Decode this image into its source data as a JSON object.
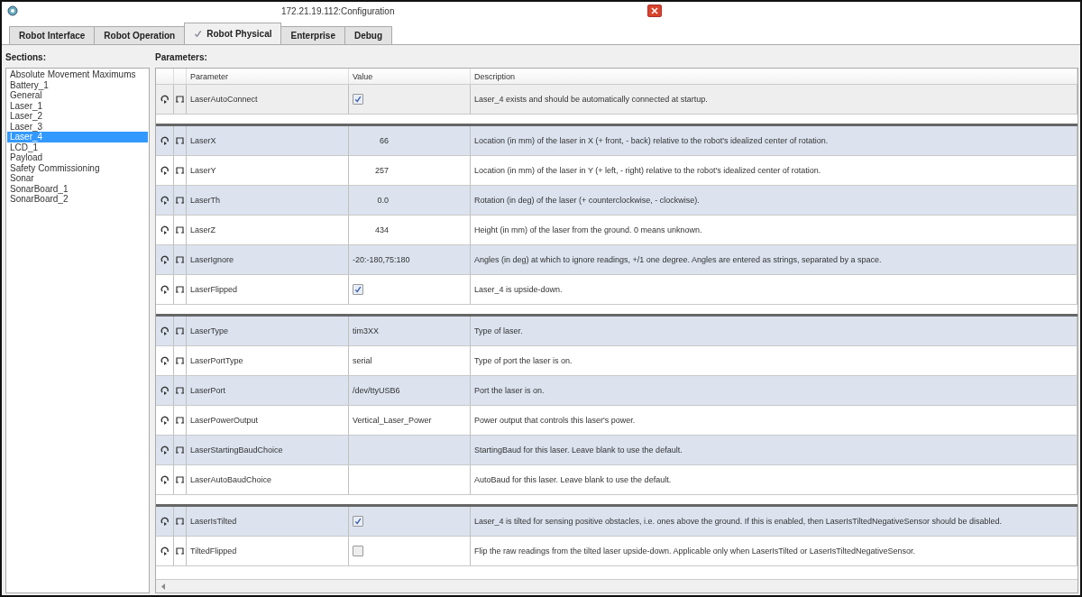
{
  "window": {
    "title": "172.21.19.112:Configuration"
  },
  "tabs": [
    {
      "label": "Robot Interface",
      "selected": false,
      "modified": false
    },
    {
      "label": "Robot Operation",
      "selected": false,
      "modified": false
    },
    {
      "label": "Robot Physical",
      "selected": true,
      "modified": true
    },
    {
      "label": "Enterprise",
      "selected": false,
      "modified": false
    },
    {
      "label": "Debug",
      "selected": false,
      "modified": false
    }
  ],
  "sections": {
    "label": "Sections:",
    "items": [
      {
        "label": "Absolute Movement Maximums",
        "selected": false
      },
      {
        "label": "Battery_1",
        "selected": false
      },
      {
        "label": "General",
        "selected": false
      },
      {
        "label": "Laser_1",
        "selected": false
      },
      {
        "label": "Laser_2",
        "selected": false
      },
      {
        "label": "Laser_3",
        "selected": false
      },
      {
        "label": "Laser_4",
        "selected": true
      },
      {
        "label": "LCD_1",
        "selected": false
      },
      {
        "label": "Payload",
        "selected": false
      },
      {
        "label": "Safety Commissioning",
        "selected": false
      },
      {
        "label": "Sonar",
        "selected": false
      },
      {
        "label": "SonarBoard_1",
        "selected": false
      },
      {
        "label": "SonarBoard_2",
        "selected": false
      }
    ]
  },
  "parameters": {
    "label": "Parameters:",
    "columns": [
      "Parameter",
      "Value",
      "Description"
    ],
    "groups": [
      {
        "rows": [
          {
            "name": "LaserAutoConnect",
            "kind": "checkbox",
            "checked": true,
            "description": "Laser_4 exists and should be automatically connected at startup.",
            "selected": true
          }
        ]
      },
      {
        "rows": [
          {
            "name": "LaserX",
            "kind": "number",
            "value": "66",
            "description": "Location (in mm) of the laser in X (+ front, - back) relative to the robot's idealized center of rotation.",
            "selected": false
          },
          {
            "name": "LaserY",
            "kind": "number",
            "value": "257",
            "description": "Location (in mm) of the laser in Y (+ left, - right) relative to the robot's idealized center of rotation.",
            "selected": false
          },
          {
            "name": "LaserTh",
            "kind": "number",
            "value": "0.0",
            "description": "Rotation (in deg) of the laser (+ counterclockwise, - clockwise).",
            "selected": false
          },
          {
            "name": "LaserZ",
            "kind": "number",
            "value": "434",
            "description": "Height (in mm) of the laser from the ground. 0 means unknown.",
            "selected": false
          },
          {
            "name": "LaserIgnore",
            "kind": "text",
            "value": "-20:-180,75:180",
            "description": "Angles (in deg) at which to ignore readings, +/1 one degree. Angles are entered as strings, separated by a space.",
            "selected": false
          },
          {
            "name": "LaserFlipped",
            "kind": "checkbox",
            "checked": true,
            "description": "Laser_4 is upside-down.",
            "selected": false
          }
        ]
      },
      {
        "rows": [
          {
            "name": "LaserType",
            "kind": "text",
            "value": "tim3XX",
            "description": "Type of laser.",
            "selected": false
          },
          {
            "name": "LaserPortType",
            "kind": "text",
            "value": "serial",
            "description": "Type of port the laser is on.",
            "selected": false
          },
          {
            "name": "LaserPort",
            "kind": "text",
            "value": "/dev/ttyUSB6",
            "description": "Port the laser is on.",
            "selected": false
          },
          {
            "name": "LaserPowerOutput",
            "kind": "text",
            "value": "Vertical_Laser_Power",
            "description": "Power output that controls this laser's power.",
            "selected": false
          },
          {
            "name": "LaserStartingBaudChoice",
            "kind": "empty",
            "description": "StartingBaud for this laser. Leave blank to use the default.",
            "selected": false
          },
          {
            "name": "LaserAutoBaudChoice",
            "kind": "empty",
            "description": "AutoBaud for this laser. Leave blank to use the default.",
            "selected": false
          }
        ]
      },
      {
        "rows": [
          {
            "name": "LaserIsTilted",
            "kind": "checkbox",
            "checked": true,
            "description": "Laser_4 is tilted for sensing positive obstacles, i.e. ones above the ground.  If this is enabled, then LaserIsTiltedNegativeSensor should be disabled.",
            "selected": false
          },
          {
            "name": "TiltedFlipped",
            "kind": "checkbox",
            "checked": false,
            "description": "Flip the raw readings from the tilted laser upside-down. Applicable only when LaserIsTilted or LaserIsTiltedNegativeSensor.",
            "selected": false
          }
        ]
      }
    ]
  }
}
